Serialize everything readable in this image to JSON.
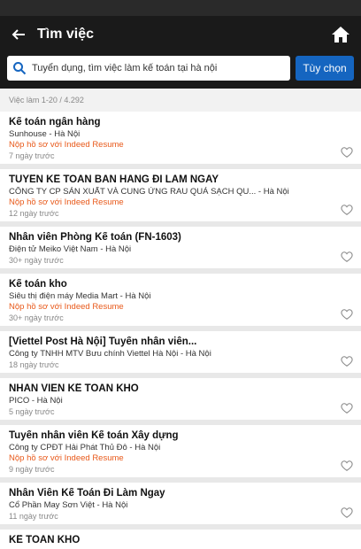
{
  "header": {
    "title": "Tìm việc"
  },
  "search": {
    "value": "Tuyển dụng, tìm việc làm kế toán tại hà nội",
    "options_label": "Tùy chọn"
  },
  "results": {
    "count_text": "Việc làm 1-20 / 4.292"
  },
  "jobs": [
    {
      "title": "Kế toán ngân hàng",
      "company": "Sunhouse - Hà Nội",
      "apply": "Nộp hồ sơ với Indeed Resume",
      "date": "7 ngày trước"
    },
    {
      "title": "TUYỂN KẾ TOÁN BÁN HÀNG ĐI LÀM NGAY",
      "company": "CÔNG TY CP SẢN XUẤT VÀ CUNG ỨNG RAU QUẢ SẠCH QU... - Hà Nội",
      "apply": "Nộp hồ sơ với Indeed Resume",
      "date": "12 ngày trước"
    },
    {
      "title": "Nhân viên Phòng Kế toán (FN-1603)",
      "company": "Điện tử Meiko Việt Nam - Hà Nội",
      "apply": "",
      "date": "30+ ngày trước"
    },
    {
      "title": "Kế toán kho",
      "company": "Siêu thị điện máy Media Mart - Hà Nội",
      "apply": "Nộp hồ sơ với Indeed Resume",
      "date": "30+ ngày trước"
    },
    {
      "title": "[Viettel Post Hà Nội] Tuyển nhân viên...",
      "company": "Công ty TNHH MTV Bưu chính Viettel Hà Nội - Hà Nội",
      "apply": "",
      "date": "18 ngày trước"
    },
    {
      "title": "NHÂN VIÊN KẾ TOÁN KHO",
      "company": "PICO - Hà Nội",
      "apply": "",
      "date": "5 ngày trước"
    },
    {
      "title": "Tuyển nhân viên Kế toán Xây dựng",
      "company": "Công ty CPĐT Hải Phát Thủ Đô - Hà Nội",
      "apply": "Nộp hồ sơ với Indeed Resume",
      "date": "9 ngày trước"
    },
    {
      "title": "Nhân Viên Kế Toán Đi Làm Ngay",
      "company": "Cổ Phần May Sơn Việt - Hà Nội",
      "apply": "",
      "date": "11 ngày trước"
    },
    {
      "title": "KẾ TOÁN KHO",
      "company": "",
      "apply": "",
      "date": ""
    }
  ],
  "colors": {
    "appbar": "#1a1a1a",
    "button": "#1565c0",
    "apply_text": "#e8591a"
  }
}
